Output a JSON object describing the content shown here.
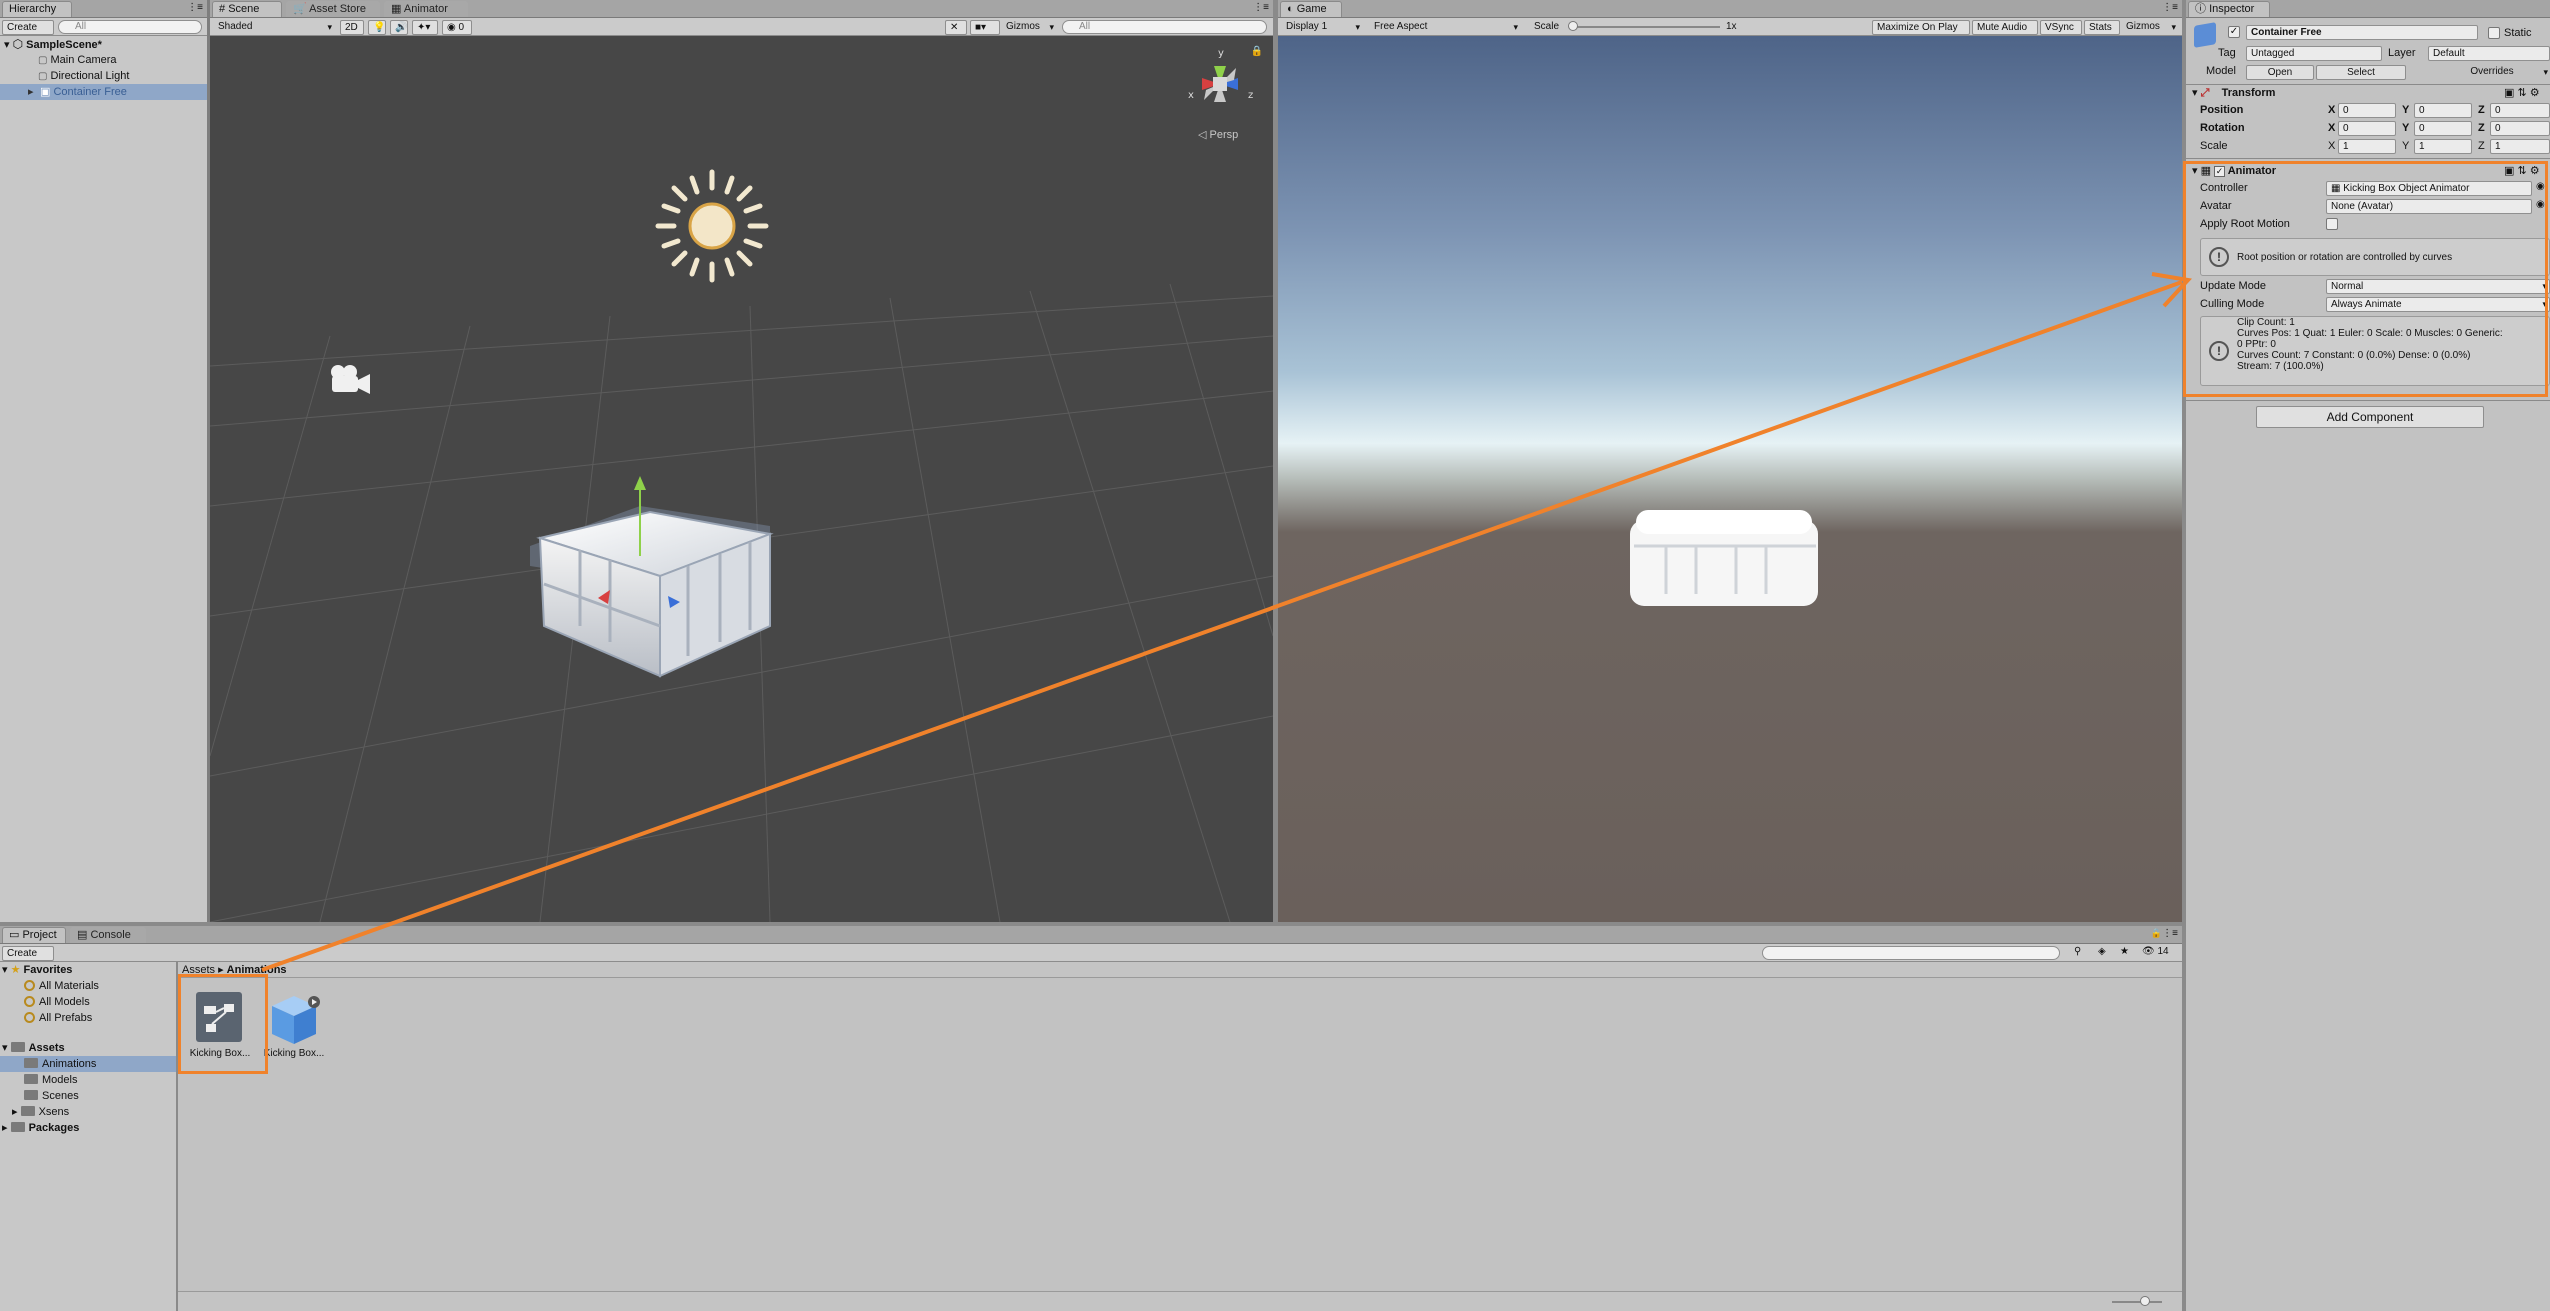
{
  "hierarchy": {
    "tab": "Hierarchy",
    "create": "Create",
    "search_placeholder": "All",
    "scene": "SampleScene*",
    "items": [
      "Main Camera",
      "Directional Light",
      "Container Free"
    ]
  },
  "scene_view": {
    "tabs": [
      "Scene",
      "Asset Store",
      "Animator"
    ],
    "shading": "Shaded",
    "mode_2d": "2D",
    "layers_count": "0",
    "gizmos": "Gizmos",
    "search_placeholder": "All",
    "persp": "Persp",
    "axes": {
      "x": "x",
      "y": "y",
      "z": "z"
    }
  },
  "game_view": {
    "tab": "Game",
    "display": "Display 1",
    "aspect": "Free Aspect",
    "scale_label": "Scale",
    "scale_value": "1x",
    "buttons": [
      "Maximize On Play",
      "Mute Audio",
      "VSync",
      "Stats",
      "Gizmos"
    ]
  },
  "inspector": {
    "tab": "Inspector",
    "object_name": "Container Free",
    "static_label": "Static",
    "tag_label": "Tag",
    "tag_value": "Untagged",
    "layer_label": "Layer",
    "layer_value": "Default",
    "model_label": "Model",
    "model_buttons": [
      "Open",
      "Select",
      "Overrides"
    ],
    "transform": {
      "title": "Transform",
      "rows": [
        {
          "label": "Position",
          "x": "0",
          "y": "0",
          "z": "0"
        },
        {
          "label": "Rotation",
          "x": "0",
          "y": "0",
          "z": "0"
        },
        {
          "label": "Scale",
          "x": "1",
          "y": "1",
          "z": "1"
        }
      ],
      "axis_x": "X",
      "axis_y": "Y",
      "axis_z": "Z"
    },
    "animator": {
      "title": "Animator",
      "controller_label": "Controller",
      "controller_value": "Kicking Box Object Animator",
      "avatar_label": "Avatar",
      "avatar_value": "None (Avatar)",
      "root_motion_label": "Apply Root Motion",
      "help_text": "Root position or rotation are controlled by curves",
      "update_mode_label": "Update Mode",
      "update_mode_value": "Normal",
      "culling_mode_label": "Culling Mode",
      "culling_mode_value": "Always Animate",
      "info_lines": [
        "Clip Count: 1",
        "Curves Pos: 1 Quat: 1 Euler: 0 Scale: 0 Muscles: 0 Generic:",
        "0 PPtr: 0",
        "Curves Count: 7 Constant: 0 (0.0%) Dense: 0 (0.0%)",
        "Stream: 7 (100.0%)"
      ]
    },
    "add_component": "Add Component"
  },
  "project": {
    "tabs": [
      "Project",
      "Console"
    ],
    "create": "Create",
    "count": "14",
    "favorites": "Favorites",
    "favorite_items": [
      "All Materials",
      "All Models",
      "All Prefabs"
    ],
    "assets": "Assets",
    "asset_folders": [
      "Animations",
      "Models",
      "Scenes",
      "Xsens"
    ],
    "packages": "Packages",
    "breadcrumb_root": "Assets",
    "breadcrumb_current": "Animations",
    "files": [
      "Kicking Box...",
      "Kicking Box..."
    ]
  },
  "colors": {
    "highlight": "#f0822b",
    "selection": "#8fa7c8"
  }
}
